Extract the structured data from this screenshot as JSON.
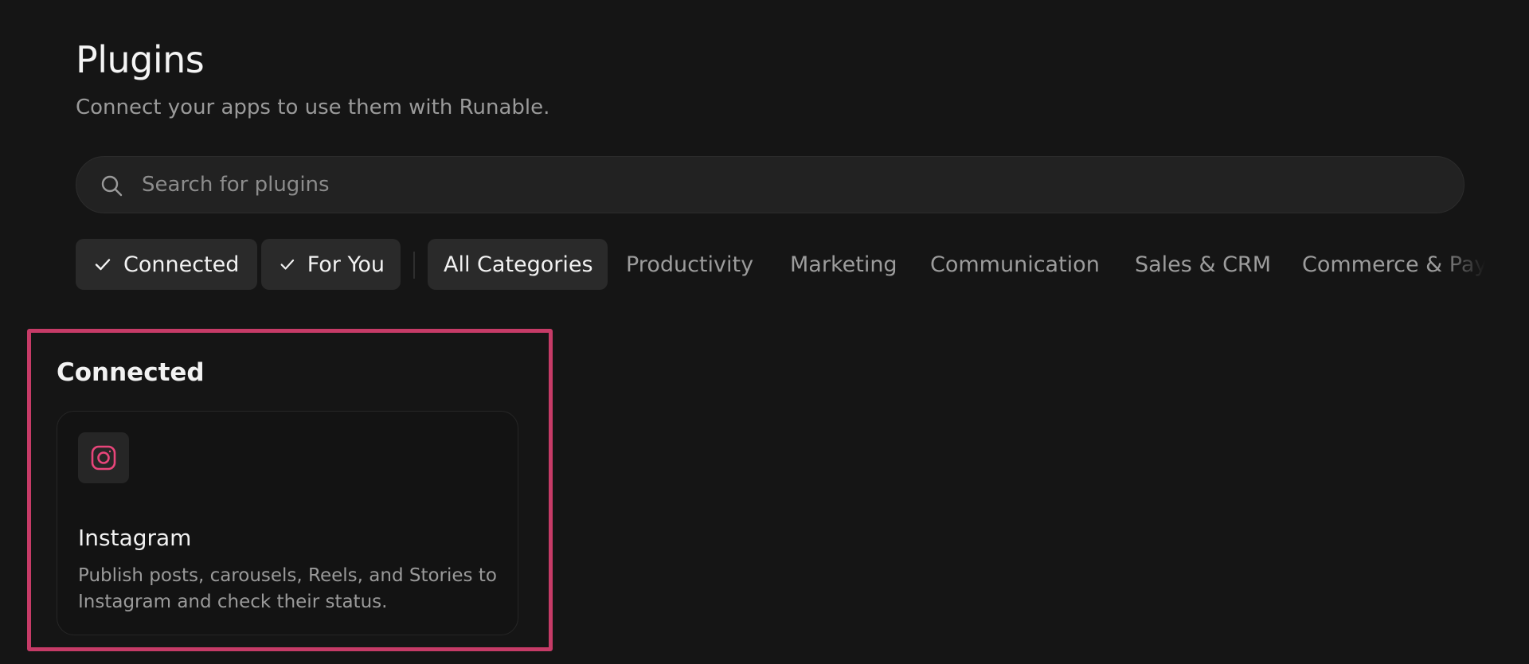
{
  "header": {
    "title": "Plugins",
    "subtitle": "Connect your apps to use them with Runable."
  },
  "search": {
    "placeholder": "Search for plugins",
    "value": "",
    "icon": "search-icon"
  },
  "filters": {
    "toggles": [
      {
        "label": "Connected",
        "checked": true,
        "icon": "check-icon"
      },
      {
        "label": "For You",
        "checked": true,
        "icon": "check-icon"
      }
    ],
    "categories": [
      {
        "label": "All Categories",
        "selected": true
      },
      {
        "label": "Productivity",
        "selected": false
      },
      {
        "label": "Marketing",
        "selected": false
      },
      {
        "label": "Communication",
        "selected": false
      },
      {
        "label": "Sales & CRM",
        "selected": false
      },
      {
        "label": "Commerce & Payments",
        "selected": false
      }
    ]
  },
  "connected_section": {
    "title": "Connected",
    "highlight_color": "#c63b67",
    "plugins": [
      {
        "name": "Instagram",
        "description": "Publish posts, carousels, Reels, and Stories to Instagram and check their status.",
        "icon": "instagram-icon",
        "icon_color": "#e8457a"
      }
    ]
  }
}
